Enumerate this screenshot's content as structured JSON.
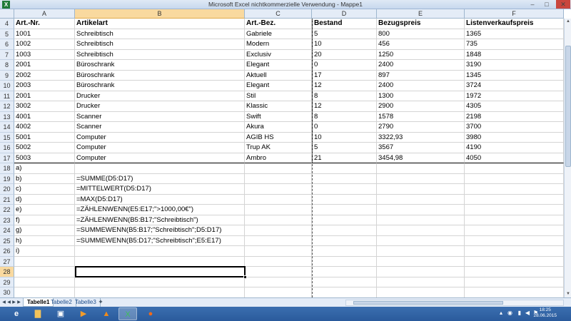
{
  "window": {
    "title": "Microsoft Excel nichtkommerzielle Verwendung - Mappe1",
    "minimize": "–",
    "maximize": "□",
    "close": "✕"
  },
  "columns": [
    "A",
    "B",
    "C",
    "D",
    "E",
    "F"
  ],
  "selected_column": "B",
  "selected_row": "28",
  "rows": [
    {
      "n": "4",
      "cells": [
        "Art.-Nr.",
        "Artikelart",
        "Art.-Bez.",
        "Bestand",
        "Bezugspreis",
        "Listenverkaufspreis"
      ]
    },
    {
      "n": "5",
      "cells": [
        "1001",
        "Schreibtisch",
        "Gabriele",
        "5",
        "800",
        "1365"
      ]
    },
    {
      "n": "6",
      "cells": [
        "1002",
        "Schreibtisch",
        "Modern",
        "10",
        "456",
        "735"
      ]
    },
    {
      "n": "7",
      "cells": [
        "1003",
        "Schreibtisch",
        "Exclusiv",
        "20",
        "1250",
        "1848"
      ]
    },
    {
      "n": "8",
      "cells": [
        "2001",
        "Büroschrank",
        "Elegant",
        "0",
        "2400",
        "3190"
      ]
    },
    {
      "n": "9",
      "cells": [
        "2002",
        "Büroschrank",
        "Aktuell",
        "17",
        "897",
        "1345"
      ]
    },
    {
      "n": "10",
      "cells": [
        "2003",
        "Büroschrank",
        "Elegant",
        "12",
        "2400",
        "3724"
      ]
    },
    {
      "n": "11",
      "cells": [
        "2001",
        "Drucker",
        "Stil",
        "8",
        "1300",
        "1972"
      ]
    },
    {
      "n": "12",
      "cells": [
        "3002",
        "Drucker",
        "Klassic",
        "12",
        "2900",
        "4305"
      ]
    },
    {
      "n": "13",
      "cells": [
        "4001",
        "Scanner",
        "Swift",
        "8",
        "1578",
        "2198"
      ]
    },
    {
      "n": "14",
      "cells": [
        "4002",
        "Scanner",
        "Akura",
        "0",
        "2790",
        "3700"
      ]
    },
    {
      "n": "15",
      "cells": [
        "5001",
        "Computer",
        "AGIB HS",
        "10",
        "3322,93",
        "3980"
      ]
    },
    {
      "n": "16",
      "cells": [
        "5002",
        "Computer",
        "Trup AK",
        "5",
        "3567",
        "4190"
      ]
    },
    {
      "n": "17",
      "cells": [
        "5003",
        "Computer",
        "Ambro",
        "21",
        "3454,98",
        "4050"
      ]
    },
    {
      "n": "18",
      "cells": [
        "a)",
        "",
        "",
        "",
        "",
        ""
      ]
    },
    {
      "n": "19",
      "cells": [
        "b)",
        "=SUMME(D5:D17)",
        "",
        "",
        "",
        ""
      ]
    },
    {
      "n": "20",
      "cells": [
        "c)",
        "=MITTELWERT(D5:D17)",
        "",
        "",
        "",
        ""
      ]
    },
    {
      "n": "21",
      "cells": [
        "d)",
        "=MAX(D5:D17)",
        "",
        "",
        "",
        ""
      ]
    },
    {
      "n": "22",
      "cells": [
        "e)",
        "=ZÄHLENWENN(E5:E17;\">1000,00€\")",
        "",
        "",
        "",
        ""
      ]
    },
    {
      "n": "23",
      "cells": [
        "f)",
        "=ZÄHLENWENN(B5:B17;\"Schreibtisch\")",
        "",
        "",
        "",
        ""
      ]
    },
    {
      "n": "24",
      "cells": [
        "g)",
        "=SUMMEWENN(B5:B17;\"Schreibtisch\";D5:D17)",
        "",
        "",
        "",
        ""
      ]
    },
    {
      "n": "25",
      "cells": [
        "h)",
        "=SUMMEWENN(B5:D17;\"Schreibtisch\";E5:E17)",
        "",
        "",
        "",
        ""
      ]
    },
    {
      "n": "26",
      "cells": [
        "i)",
        "",
        "",
        "",
        "",
        ""
      ]
    },
    {
      "n": "27",
      "cells": [
        "",
        "",
        "",
        "",
        "",
        ""
      ]
    },
    {
      "n": "28",
      "cells": [
        "",
        "",
        "",
        "",
        "",
        ""
      ]
    },
    {
      "n": "29",
      "cells": [
        "",
        "",
        "",
        "",
        "",
        ""
      ]
    },
    {
      "n": "30",
      "cells": [
        "",
        "",
        "",
        "",
        "",
        ""
      ]
    }
  ],
  "sheet_tabs": [
    {
      "label": "Tabelle1",
      "active": true
    },
    {
      "label": "Tabelle2",
      "active": false
    },
    {
      "label": "Tabelle3",
      "active": false
    }
  ],
  "taskbar": {
    "items": [
      "start-orb",
      "internet-explorer",
      "file-explorer",
      "word",
      "media-player",
      "vlc",
      "excel",
      "firefox"
    ],
    "clock_time": "18:25",
    "clock_date": "28.06.2015"
  },
  "colors": {
    "accent": "#f9d99f",
    "header_bg": "#e4ecf7",
    "taskbar": "#2a5a9c",
    "excel_green": "#1f7a3a"
  }
}
